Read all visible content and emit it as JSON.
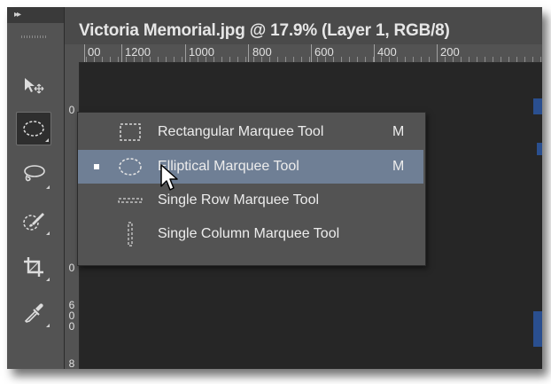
{
  "window": {
    "document_title": "Victoria Memorial.jpg @ 17.9% (Layer 1, RGB/8)",
    "panel_collapse_glyph": "▸▸"
  },
  "ruler": {
    "horizontal_labels": [
      "00",
      "1200",
      "1000",
      "800",
      "600",
      "400",
      "200"
    ],
    "vertical_labels": [
      "0",
      "0",
      "6 0 0",
      "8"
    ]
  },
  "tools": [
    {
      "icon": "move-icon",
      "active": false
    },
    {
      "icon": "elliptical-marquee-icon",
      "active": true
    },
    {
      "icon": "lasso-icon",
      "active": false
    },
    {
      "icon": "quick-selection-icon",
      "active": false
    },
    {
      "icon": "crop-icon",
      "active": false
    },
    {
      "icon": "eyedropper-icon",
      "active": false
    }
  ],
  "flyout_menu": {
    "items": [
      {
        "label": "Rectangular Marquee Tool",
        "shortcut": "M",
        "icon": "rectangular-marquee-icon",
        "selected": false
      },
      {
        "label": "Elliptical Marquee Tool",
        "shortcut": "M",
        "icon": "elliptical-marquee-icon",
        "selected": true
      },
      {
        "label": "Single Row Marquee Tool",
        "shortcut": "",
        "icon": "single-row-marquee-icon",
        "selected": false
      },
      {
        "label": "Single Column Marquee Tool",
        "shortcut": "",
        "icon": "single-column-marquee-icon",
        "selected": false
      }
    ]
  },
  "colors": {
    "panel": "#535353",
    "document_bg": "#262626",
    "menu_selected": "#6f7f95",
    "accent_blue": "#2a4f8f"
  }
}
